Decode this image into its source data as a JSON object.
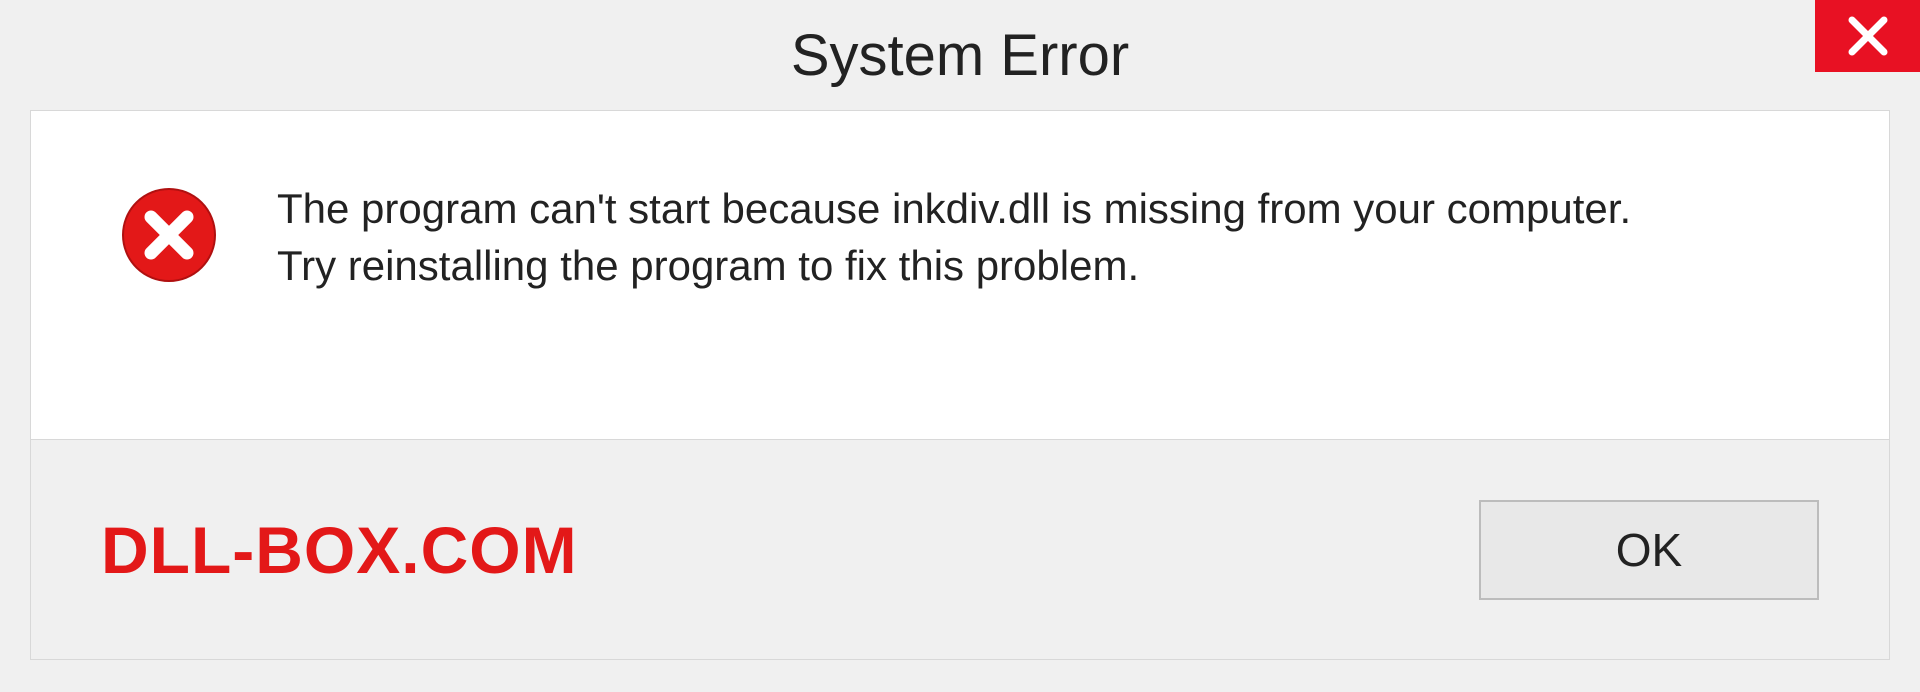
{
  "dialog": {
    "title": "System Error",
    "message_line1": "The program can't start because inkdiv.dll is missing from your computer.",
    "message_line2": "Try reinstalling the program to fix this problem.",
    "ok_label": "OK"
  },
  "watermark": "DLL-BOX.COM",
  "colors": {
    "close_bg": "#e81123",
    "error_icon": "#e31818",
    "watermark": "#e31818"
  }
}
